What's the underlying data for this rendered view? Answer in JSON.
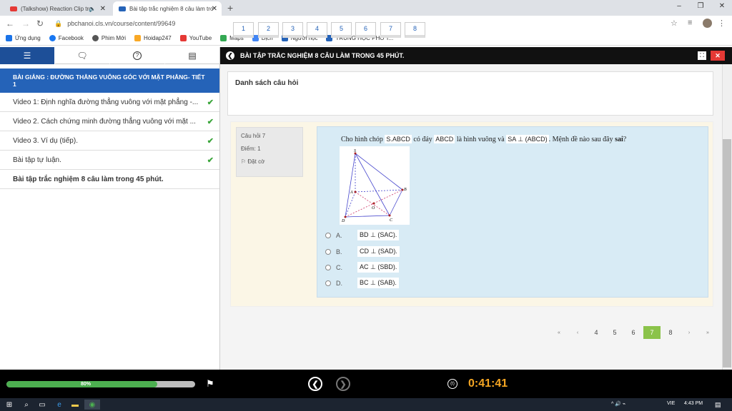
{
  "browser": {
    "tabs": [
      {
        "title": "(Talkshow) Reaction Clip tro",
        "audio": "🔈",
        "close": "✕",
        "fav_color": "#e53935"
      },
      {
        "title": "Bài tập trắc nghiệm 8 câu làm tro",
        "close": "✕",
        "fav_color": "#2563b8"
      }
    ],
    "new_tab": "+",
    "window_controls": [
      "–",
      "❐",
      "✕"
    ],
    "url": "pbchanoi.cls.vn/course/content/99649",
    "bookmarks": [
      {
        "label": "Ứng dụng",
        "icon_color": "#1a73e8"
      },
      {
        "label": "Facebook",
        "icon_color": "#1877f2"
      },
      {
        "label": "Phim Mới",
        "icon_color": "#555555"
      },
      {
        "label": "Hoidap247",
        "icon_color": "#f9a825"
      },
      {
        "label": "YouTube",
        "icon_color": "#e53935"
      },
      {
        "label": "Maps",
        "icon_color": "#34a853"
      },
      {
        "label": "Dịch",
        "icon_color": "#4285f4"
      },
      {
        "label": "Người học",
        "icon_color": "#2563b8"
      },
      {
        "label": "TRUNG HỌC PHỔ T...",
        "icon_color": "#2563b8"
      }
    ]
  },
  "sidebar": {
    "tabs": [
      {
        "icon": "list-icon",
        "glyph": "☰"
      },
      {
        "icon": "chat-icon",
        "glyph": "💬"
      },
      {
        "icon": "help-icon",
        "glyph": "?"
      },
      {
        "icon": "document-icon",
        "glyph": "▤"
      }
    ],
    "lesson_title": "BÀI GIẢNG : ĐƯỜNG THẲNG VUÔNG GÓC VỚI MẶT PHẲNG- TIẾT 1",
    "items": [
      {
        "label": "Video 1: Định nghĩa đường thẳng vuông với mặt phẳng -...",
        "done": "✔"
      },
      {
        "label": "Video 2. Cách chứng minh đường thẳng vuông với mặt ...",
        "done": "✔"
      },
      {
        "label": "Video 3. Ví dụ (tiếp).",
        "done": "✔"
      },
      {
        "label": "Bài tập tự luận.",
        "done": "✔"
      },
      {
        "label": "Bài tập trắc nghiệm 8 câu làm trong 45 phút.",
        "done": ""
      }
    ]
  },
  "topbar": {
    "title": "BÀI TẬP TRẮC NGHIỆM 8 CÂU LÀM TRONG 45 PHÚT.",
    "back": "❮",
    "fullscreen": "⛶",
    "close": "✕"
  },
  "question_list": {
    "header": "Danh sách câu hỏi",
    "numbers": [
      "1",
      "2",
      "3",
      "4",
      "5",
      "6",
      "7",
      "8"
    ]
  },
  "question": {
    "number_label": "Câu hỏi 7",
    "score_label": "Điểm: 1",
    "flag_label": "Đặt cờ",
    "text_1": "Cho hình chóp ",
    "m1": "S.ABCD",
    "text_2": " có đáy ",
    "m2": "ABCD",
    "text_3": " là hình vuông và ",
    "m3": "SA ⊥ (ABCD)",
    "text_4": ". Mệnh đề nào sau đây ",
    "bold": "sai",
    "text_5": "?",
    "figure_labels": {
      "S": "S",
      "A": "A",
      "B": "B",
      "C": "C",
      "D": "D",
      "O": "O"
    },
    "options": [
      {
        "letter": "A.",
        "math": "BD ⊥ (SAC)."
      },
      {
        "letter": "B.",
        "math": "CD ⊥ (SAD)."
      },
      {
        "letter": "C.",
        "math": "AC ⊥ (SBD)."
      },
      {
        "letter": "D.",
        "math": "BC ⊥ (SAB)."
      }
    ]
  },
  "pager": {
    "first": "«",
    "prev": "‹",
    "pages": [
      "4",
      "5",
      "6",
      "7",
      "8"
    ],
    "active": "7",
    "next": "›",
    "last": "»"
  },
  "bottom": {
    "progress_percent": 80,
    "progress_label": "80%",
    "timer": "0:41:41",
    "prev": "❮",
    "next": "❯",
    "flag": "⚑",
    "clock": "(t)"
  },
  "taskbar": {
    "time": "4:43 PM",
    "lang": "VIE",
    "tray": "^  🔊  ⌁"
  },
  "colors": {
    "primary": "#2563b8",
    "accent_green": "#8bc34a",
    "timer_orange": "#f5a623",
    "question_bg": "#d8ebf5"
  }
}
